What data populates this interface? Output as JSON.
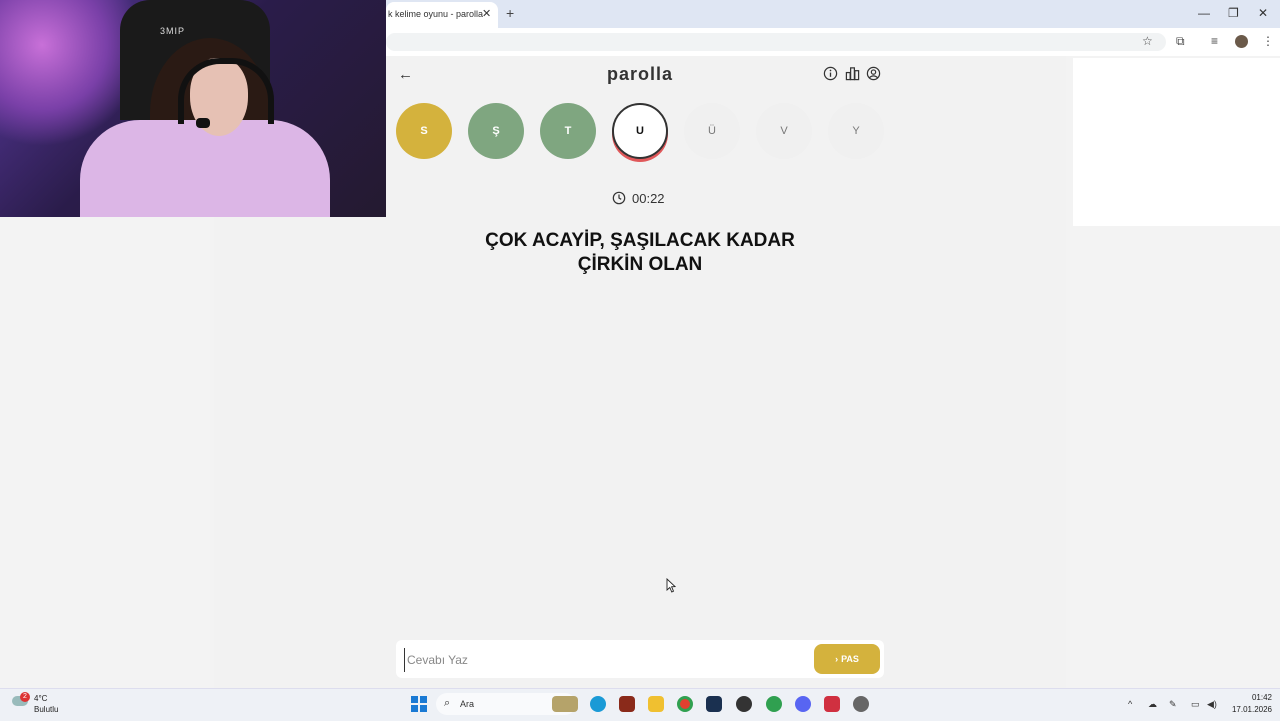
{
  "browser": {
    "tab_title": "k kelime oyunu - parolla",
    "tab_close": "✕",
    "new_tab": "+",
    "minimize": "—",
    "restore": "❐",
    "close": "✕"
  },
  "webcam": {
    "chair_logo": "3MIP"
  },
  "game": {
    "logo": "parolla",
    "back_icon": "←",
    "letters": [
      {
        "letter": "S",
        "state": "yellow"
      },
      {
        "letter": "Ş",
        "state": "green"
      },
      {
        "letter": "T",
        "state": "green"
      },
      {
        "letter": "U",
        "state": "active"
      },
      {
        "letter": "Ü",
        "state": "empty"
      },
      {
        "letter": "V",
        "state": "empty"
      },
      {
        "letter": "Y",
        "state": "empty"
      }
    ],
    "timer": "00:22",
    "question_line1": "ÇOK ACAYİP, ŞAŞILACAK KADAR",
    "question_line2": "ÇİRKİN OLAN",
    "answer_placeholder": "Cevabı Yaz",
    "pass_label": "PAS",
    "pass_icon": "›"
  },
  "taskbar": {
    "weather_badge": "2",
    "weather_temp": "4°C",
    "weather_desc": "Bulutlu",
    "search_placeholder": "Ara",
    "time": "01:42",
    "date": "17.01.2026"
  },
  "colors": {
    "yellow": "#d4b23d",
    "green": "#7fa680",
    "active_ring": "#e0585a"
  }
}
